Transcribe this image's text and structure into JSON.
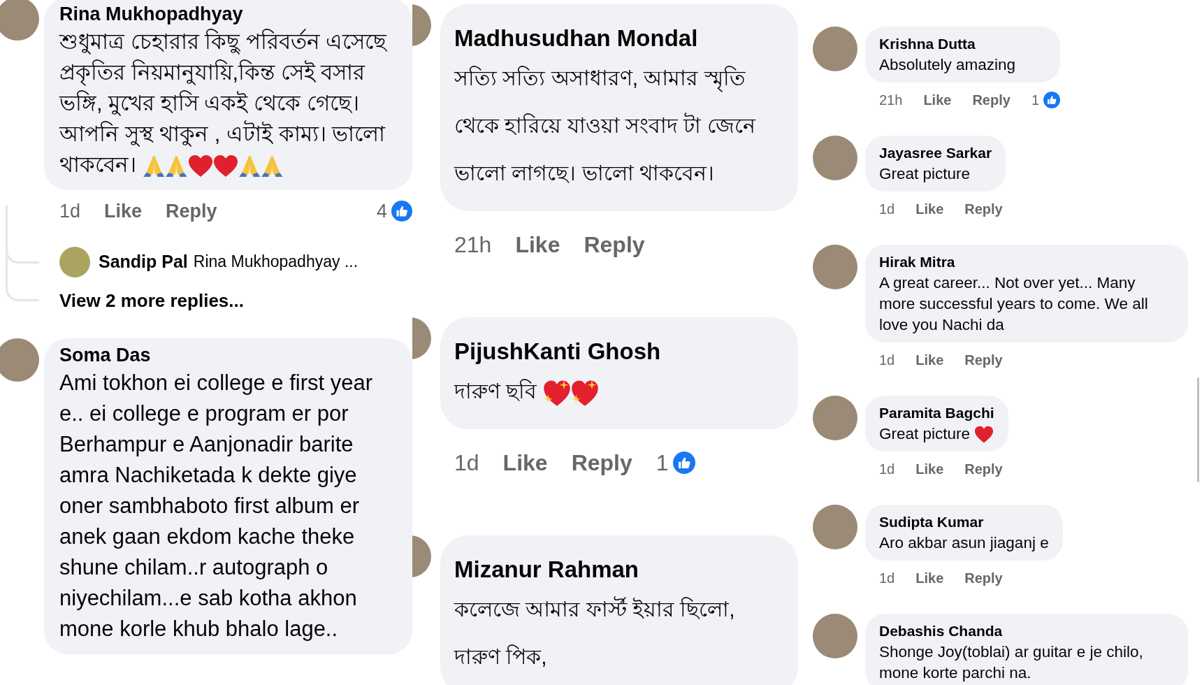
{
  "columns": [
    {
      "comments": [
        {
          "name": "Rina Mukhopadhyay",
          "text": "শুধুমাত্র  চেহারার  কিছু পরিবর্তন এসেছে প্রকৃতির  নিয়মানুযায়ি,কিন্ত সেই  বসার ভঙ্গি, মুখের  হাসি একই থেকে গেছে। আপনি সুস্থ  থাকুন , এটাই  কাম্য। ভালো থাকবেন।",
          "emoji": [
            {
              "kind": "pray"
            },
            {
              "kind": "pray"
            },
            {
              "kind": "heart"
            },
            {
              "kind": "heart"
            },
            {
              "kind": "pray"
            },
            {
              "kind": "pray"
            }
          ],
          "time": "1d",
          "actions": [
            "Like",
            "Reply"
          ],
          "reaction_count": "4",
          "reply_preview": {
            "name": "Sandip Pal",
            "text": "Rina Mukhopadhyay ..."
          },
          "more_replies": "View 2 more replies..."
        },
        {
          "name": "Soma Das",
          "text": "Ami tokhon ei  college e first year e.. ei college e program er por Berhampur e Aanjonadir barite amra Nachiketada k dekte giye oner sambhaboto first album er anek gaan ekdom kache theke shune chilam..r autograph o niyechilam...e sab kotha akhon mone korle khub bhalo lage.."
        }
      ]
    },
    {
      "comments": [
        {
          "name": "Madhusudhan Mondal",
          "text": "সত্যি সত্যি অসাধারণ, আমার স্মৃতি থেকে হারিয়ে যাওয়া সংবাদ টা জেনে ভালো লাগছে। ভালো থাকবেন।",
          "time": "21h",
          "actions": [
            "Like",
            "Reply"
          ]
        },
        {
          "name": "PijushKanti Ghosh",
          "text": "দারুণ ছবি",
          "emoji": [
            {
              "kind": "sparkle-heart"
            },
            {
              "kind": "sparkle-heart"
            }
          ],
          "time": "1d",
          "actions": [
            "Like",
            "Reply"
          ],
          "reaction_count": "1"
        },
        {
          "name": "Mizanur Rahman",
          "text": "কলেজে আমার ফার্স্ট ইয়ার ছিলো, দারুণ পিক,"
        }
      ]
    },
    {
      "comments": [
        {
          "name": "Krishna Dutta",
          "text": "Absolutely amazing",
          "time": "21h",
          "actions": [
            "Like",
            "Reply"
          ],
          "reaction_count": "1"
        },
        {
          "name": "Jayasree Sarkar",
          "text": "Great picture",
          "time": "1d",
          "actions": [
            "Like",
            "Reply"
          ]
        },
        {
          "name": "Hirak Mitra",
          "text": "A great career... Not over yet... Many more successful years to come. We all love you Nachi da",
          "time": "1d",
          "actions": [
            "Like",
            "Reply"
          ]
        },
        {
          "name": "Paramita Bagchi",
          "text": "Great picture",
          "emoji": [
            {
              "kind": "heart"
            }
          ],
          "time": "1d",
          "actions": [
            "Like",
            "Reply"
          ]
        },
        {
          "name": "Sudipta Kumar",
          "text": "Aro akbar asun jiaganj e",
          "time": "1d",
          "actions": [
            "Like",
            "Reply"
          ]
        },
        {
          "name": "Debashis Chanda",
          "text": "Shonge Joy(toblai) ar guitar e je chilo, mone korte parchi na."
        }
      ]
    }
  ]
}
